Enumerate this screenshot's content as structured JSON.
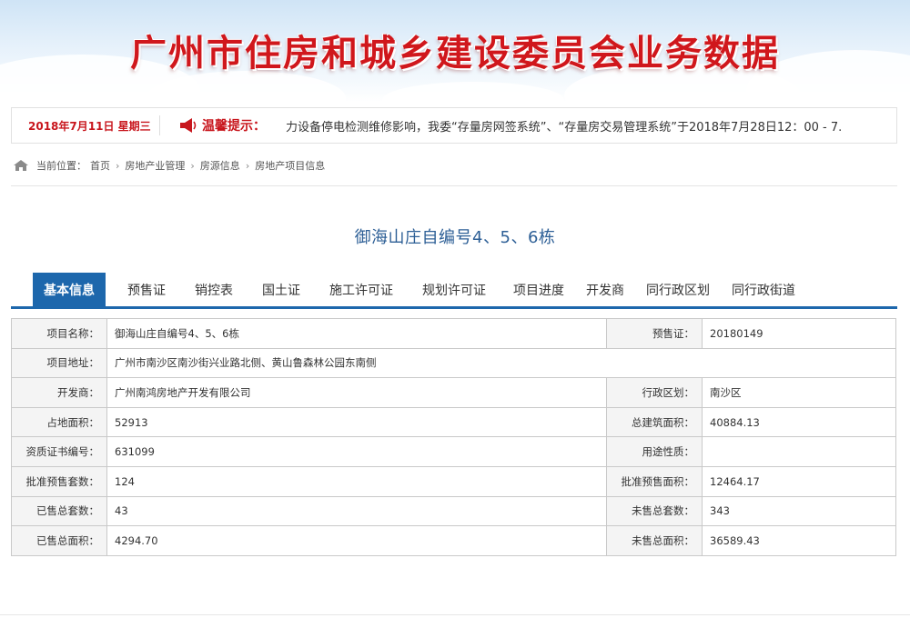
{
  "banner": {
    "title": "广州市住房和城乡建设委员会业务数据"
  },
  "notice": {
    "date": "2018年7月11日 星期三",
    "tip_label": "温馨提示：",
    "marquee": "力设备停电检测维修影响，我委“存量房网签系统”、“存量房交易管理系统”于2018年7月28日12：00 - 7."
  },
  "breadcrumb": {
    "prefix": "当前位置：",
    "items": [
      "首页",
      "房地产业管理",
      "房源信息",
      "房地产项目信息"
    ]
  },
  "project": {
    "title": "御海山庄自编号4、5、6栋"
  },
  "tabs": [
    "基本信息",
    "预售证",
    "销控表",
    "国土证",
    "施工许可证",
    "规划许可证",
    "项目进度",
    "开发商",
    "同行政区划",
    "同行政街道"
  ],
  "info": {
    "rows": [
      {
        "l1": "项目名称：",
        "v1": "御海山庄自编号4、5、6栋",
        "l2": "预售证：",
        "v2": "20180149"
      },
      {
        "l1": "项目地址：",
        "v1": "广州市南沙区南沙街兴业路北侧、黄山鲁森林公园东南侧"
      },
      {
        "l1": "开发商：",
        "v1": "广州南鸿房地产开发有限公司",
        "l2": "行政区划：",
        "v2": "南沙区"
      },
      {
        "l1": "占地面积：",
        "v1": "52913",
        "l2": "总建筑面积：",
        "v2": "40884.13"
      },
      {
        "l1": "资质证书编号：",
        "v1": "631099",
        "l2": "用途性质：",
        "v2": ""
      },
      {
        "l1": "批准预售套数：",
        "v1": "124",
        "l2": "批准预售面积：",
        "v2": "12464.17"
      },
      {
        "l1": "已售总套数：",
        "v1": "43",
        "l2": "未售总套数：",
        "v2": "343"
      },
      {
        "l1": "已售总面积：",
        "v1": "4294.70",
        "l2": "未售总面积：",
        "v2": "36589.43"
      }
    ]
  },
  "colors": {
    "accent": "#1d67ac",
    "title_red": "#d0171c",
    "project_title": "#2d5f96"
  },
  "icons": {
    "notice": "horn-icon",
    "breadcrumb": "home-icon"
  }
}
